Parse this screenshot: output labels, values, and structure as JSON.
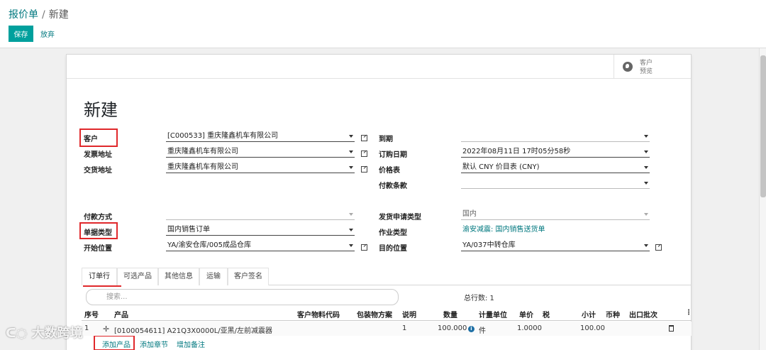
{
  "breadcrumb": {
    "parent": "报价单",
    "separator": "/",
    "current": "新建"
  },
  "buttons": {
    "save": "保存",
    "discard": "放弃"
  },
  "preview": {
    "label": "客户\n预览"
  },
  "form": {
    "title": "新建",
    "left": {
      "customer_label": "客户",
      "customer_value": "[C000533] 重庆隆鑫机车有限公司",
      "invoice_label": "发票地址",
      "invoice_value": "重庆隆鑫机车有限公司",
      "delivery_label": "交货地址",
      "delivery_value": "重庆隆鑫机车有限公司",
      "payment_method_label": "付款方式",
      "payment_method_value": "",
      "doc_type_label": "单据类型",
      "doc_type_value": "国内销售订单",
      "start_loc_label": "开始位置",
      "start_loc_value": "YA/渝安仓库/005成品仓库"
    },
    "right": {
      "due_label": "到期",
      "due_value": "",
      "order_date_label": "订购日期",
      "order_date_value": "2022年08月11日 17时05分58秒",
      "pricelist_label": "价格表",
      "pricelist_value": "默认 CNY 价目表 (CNY)",
      "payment_terms_label": "付款条款",
      "payment_terms_value": "",
      "ship_type_label": "发货申请类型",
      "ship_type_value": "国内",
      "op_type_label": "作业类型",
      "op_type_value": "渝安减震: 国内销售送货单",
      "dest_label": "目的位置",
      "dest_value": "YA/037中转仓库"
    }
  },
  "tabs": [
    "订单行",
    "可选产品",
    "其他信息",
    "运输",
    "客户签名"
  ],
  "lines": {
    "search_placeholder": "搜索...",
    "total": "总行数: 1",
    "headers": {
      "seq": "序号",
      "product": "产品",
      "cust_code": "客户物料代码",
      "package": "包装物方案",
      "desc": "说明",
      "qty": "数量",
      "uom": "计量单位",
      "price": "单价",
      "tax": "税",
      "subtotal": "小计",
      "currency": "币种",
      "lot": "出口批次"
    },
    "rows": [
      {
        "seq": "1",
        "product": "[0100054611] A21Q3X0000L/亚黑/左前减震器",
        "desc": "1",
        "qty": "100.000",
        "uom": "件",
        "price": "1.0000",
        "subtotal": "100.00"
      }
    ],
    "add_product": "添加产品",
    "add_section": "添加章节",
    "add_note": "增加备注"
  },
  "watermark": "大数跨境",
  "colors": {
    "accent": "#00a09d",
    "link": "#00787f",
    "highlight": "#e0282b"
  }
}
